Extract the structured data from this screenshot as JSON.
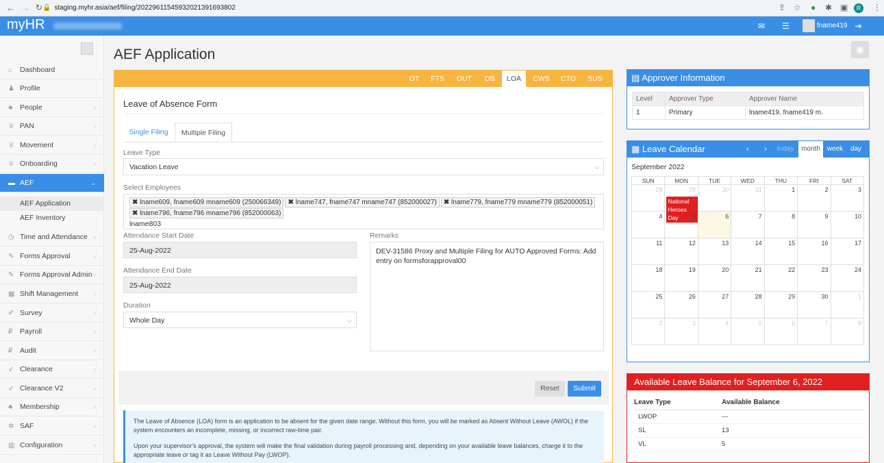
{
  "browser": {
    "url": "staging.myhr.asia/aef/filing/20229611545932021391693802",
    "profile_initial": "R"
  },
  "header": {
    "logo": "myHR",
    "username": "fname419"
  },
  "sidebar": {
    "items": [
      {
        "label": "Dashboard",
        "icon": "home-icon"
      },
      {
        "label": "Profile",
        "icon": "user-icon"
      },
      {
        "label": "People",
        "icon": "users-icon"
      },
      {
        "label": "PAN",
        "icon": "trophy-icon"
      },
      {
        "label": "Movement",
        "icon": "trophy-icon"
      },
      {
        "label": "Onboarding",
        "icon": "trophy-icon"
      },
      {
        "label": "AEF",
        "icon": "folder-icon"
      },
      {
        "label": "Time and Attendance",
        "icon": "clock-icon"
      },
      {
        "label": "Forms Approval",
        "icon": "pencil-icon"
      },
      {
        "label": "Forms Approval Admin",
        "icon": "pencil-icon"
      },
      {
        "label": "Shift Management",
        "icon": "calendar-icon"
      },
      {
        "label": "Survey",
        "icon": "edit-icon"
      },
      {
        "label": "Payroll",
        "icon": "ruble-icon"
      },
      {
        "label": "Audit",
        "icon": "ruble-icon"
      },
      {
        "label": "Clearance",
        "icon": "rocket-icon"
      },
      {
        "label": "Clearance V2",
        "icon": "rocket-icon"
      },
      {
        "label": "Membership",
        "icon": "users-icon"
      },
      {
        "label": "SAF",
        "icon": "gear-icon"
      },
      {
        "label": "Configuration",
        "icon": "chart-icon"
      }
    ],
    "subitems": [
      {
        "label": "AEF Application"
      },
      {
        "label": "AEF Inventory"
      }
    ]
  },
  "page": {
    "title": "AEF Application"
  },
  "form": {
    "tabs": [
      "OT",
      "FTS",
      "OUT",
      "OB",
      "LOA",
      "CWS",
      "CTO",
      "SUS"
    ],
    "title": "Leave of Absence Form",
    "subtabs": [
      "Single Filing",
      "Multiple Filing"
    ],
    "leave_type_label": "Leave Type",
    "leave_type_value": "Vacation Leave",
    "employees_label": "Select Employees",
    "employees": [
      "lname609, fname609 mname609 (250066349)",
      "lname747, fname747 mname747 (852000027)",
      "lname779, fname779 mname779 (852000051)",
      "lname796, fname796 mname796 (852000063)"
    ],
    "employee_input": "lname803",
    "start_label": "Attendance Start Date",
    "start_value": "25-Aug-2022",
    "end_label": "Attendance End Date",
    "end_value": "25-Aug-2022",
    "duration_label": "Duration",
    "duration_value": "Whole Day",
    "remarks_label": "Remarks",
    "remarks_value": "DEV-31586 Proxy and Multiple Filing for AUTO Approved Forms: Add entry on formsforapproval00",
    "reset_label": "Reset",
    "submit_label": "Submit",
    "info_p1": "The Leave of Absence (LOA) form is an application to be absent for the given date range. Without this form, you will be marked as Absent Without Leave (AWOL) if the system encounters an incomplete, missing, or incorrect raw-time pair.",
    "info_p2": "Upon your supervisor's approval, the system will make the final validation during payroll processing and, depending on your available leave balances, charge it to the appropriate leave or tag it as Leave Without Pay (LWOP)."
  },
  "approver": {
    "title": "Approver Information",
    "headers": [
      "Level",
      "Approver Type",
      "Approver Name"
    ],
    "rows": [
      [
        "1",
        "Primary",
        "lname419, fname419 m."
      ]
    ]
  },
  "calendar": {
    "title": "Leave Calendar",
    "buttons": {
      "today": "today",
      "month": "month",
      "week": "week",
      "day": "day"
    },
    "month_label": "September 2022",
    "weekdays": [
      "SUN",
      "MON",
      "TUE",
      "WED",
      "THU",
      "FRI",
      "SAT"
    ],
    "weeks": [
      [
        "28",
        "29",
        "30",
        "31",
        "1",
        "2",
        "3"
      ],
      [
        "4",
        "5",
        "6",
        "7",
        "8",
        "9",
        "10"
      ],
      [
        "11",
        "12",
        "13",
        "14",
        "15",
        "16",
        "17"
      ],
      [
        "18",
        "19",
        "20",
        "21",
        "22",
        "23",
        "24"
      ],
      [
        "25",
        "26",
        "27",
        "28",
        "29",
        "30",
        "1"
      ],
      [
        "2",
        "3",
        "4",
        "5",
        "6",
        "7",
        "8"
      ]
    ],
    "event": "National Heroes Day",
    "event_color": "#e02020",
    "accent": "#3a8ee6"
  },
  "balance": {
    "title": "Available Leave Balance for September 6, 2022",
    "headers": [
      "Leave Type",
      "Available Balance"
    ],
    "rows": [
      [
        "LWOP",
        "---"
      ],
      [
        "SL",
        "13"
      ],
      [
        "VL",
        "5"
      ]
    ]
  }
}
